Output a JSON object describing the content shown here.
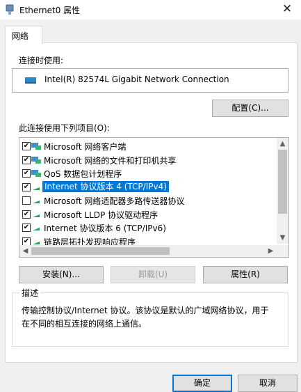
{
  "window": {
    "title": "Ethernet0 属性",
    "close_symbol": "✕"
  },
  "tabs": [
    {
      "label": "网络"
    }
  ],
  "connect_using": {
    "label": "连接时使用:",
    "adapter": "Intel(R) 82574L Gigabit Network Connection",
    "configure_button": "配置(C)..."
  },
  "items_section": {
    "label": "此连接使用下列项目(O):",
    "items": [
      {
        "label": "Microsoft 网络客户端",
        "checked": true,
        "icon": "network-client-icon"
      },
      {
        "label": "Microsoft 网络的文件和打印机共享",
        "checked": true,
        "icon": "network-share-icon"
      },
      {
        "label": "QoS 数据包计划程序",
        "checked": true,
        "icon": "network-service-icon"
      },
      {
        "label": "Internet 协议版本 4 (TCP/IPv4)",
        "checked": true,
        "selected": true,
        "icon": "protocol-icon"
      },
      {
        "label": "Microsoft 网络适配器多路传送器协议",
        "checked": false,
        "icon": "protocol-icon"
      },
      {
        "label": "Microsoft LLDP 协议驱动程序",
        "checked": true,
        "icon": "protocol-icon"
      },
      {
        "label": "Internet 协议版本 6 (TCP/IPv6)",
        "checked": true,
        "icon": "protocol-icon"
      },
      {
        "label": "链路层拓扑发现响应程序",
        "checked": true,
        "icon": "protocol-icon"
      }
    ]
  },
  "buttons": {
    "install": "安装(N)...",
    "uninstall": "卸载(U)",
    "properties": "属性(R)"
  },
  "description": {
    "title": "描述",
    "text": "传输控制协议/Internet 协议。该协议是默认的广域网络协议，用于在不同的相互连接的网络上通信。"
  },
  "footer": {
    "ok": "确定",
    "cancel": "取消"
  },
  "colors": {
    "selection": "#0078d7",
    "window_bg": "#f0f0f0",
    "panel_bg": "#ffffff"
  }
}
